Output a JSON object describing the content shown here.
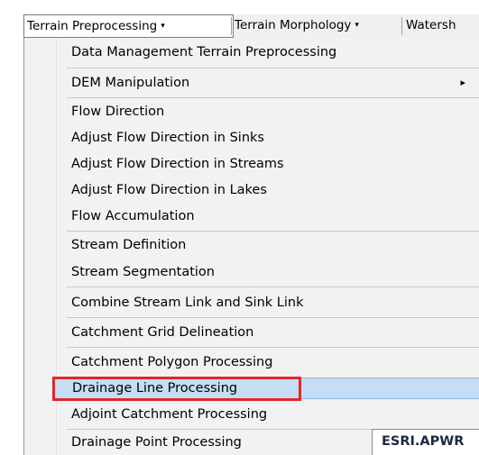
{
  "toolbar": {
    "menus": [
      {
        "label": "Terrain Preprocessing",
        "arrow": "▾"
      },
      {
        "label": "Terrain Morphology",
        "arrow": "▾"
      },
      {
        "label": "Watersh"
      }
    ]
  },
  "menu": {
    "items": [
      {
        "label": "Data Management Terrain Preprocessing"
      },
      {
        "label": "DEM Manipulation",
        "submenu_arrow": "▸"
      },
      {
        "label": "Flow Direction"
      },
      {
        "label": "Adjust Flow Direction in Sinks"
      },
      {
        "label": "Adjust Flow Direction in Streams"
      },
      {
        "label": "Adjust Flow Direction in Lakes"
      },
      {
        "label": "Flow Accumulation"
      },
      {
        "label": "Stream Definition"
      },
      {
        "label": "Stream Segmentation"
      },
      {
        "label": "Combine Stream Link and Sink Link"
      },
      {
        "label": "Catchment Grid Delineation"
      },
      {
        "label": "Catchment Polygon Processing"
      },
      {
        "label": "Drainage Line Processing",
        "highlighted": true
      },
      {
        "label": "Adjoint Catchment Processing"
      },
      {
        "label": "Drainage Point Processing"
      }
    ]
  },
  "tooltip": {
    "title": "ESRI.APWR"
  },
  "colors": {
    "highlight": "#c5def3",
    "annotation_box": "#e3262b"
  }
}
